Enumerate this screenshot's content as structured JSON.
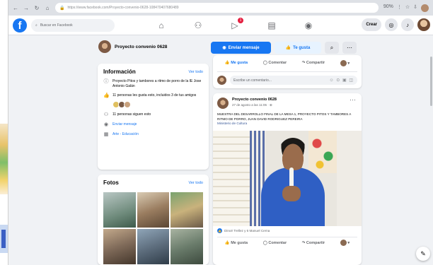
{
  "browser": {
    "url": "https://www.facebook.com/Proyecto-convenio-0628-108470407680489",
    "zoom": "90%"
  },
  "facebook": {
    "search_placeholder": "Buscar en Facebook",
    "crear_label": "Crear",
    "notification_count": "1"
  },
  "page": {
    "name": "Proyecto convenio 0628",
    "send_message_label": "Enviar mensaje",
    "like_label": "Te gusta"
  },
  "info": {
    "title": "Información",
    "see_all": "Ver todo",
    "description": "Proyecto Pitos y tambores a ritmo de porro de la IE Jose Antonio Galán",
    "likes": "11 personas les gusta esto, incluidos 3 de tus amigos",
    "followers": "11 personas siguen esto",
    "send_message": "Enviar mensaje",
    "category": "Arte - Educación"
  },
  "photos": {
    "title": "Fotos",
    "see_all": "Ver todo"
  },
  "composer": {
    "like_label": "Me gusta",
    "comment_label": "Comentar",
    "share_label": "Compartir",
    "placeholder": "Escribe un comentario...",
    "emoji_icons": "☺ ⊙ ▣ ◫"
  },
  "post": {
    "author": "Proyecto convenio 0628",
    "time": "27 de agosto a las 11:06 · ⊕",
    "text": "MUESTRA DEL DESARROLLO FINAL DE LA MESA 1,  PROYECTO PITOS Y TAMBORES A RITMO DE PORRO, JUAN DAVID RODRIGUEZ PEREIRA",
    "link": "Ministerio de Cultura",
    "reactions": "Dinoé Trellez y 6 Manuel Cerna",
    "like_label": "Me gusta",
    "comment_label": "Comentar",
    "share_label": "Compartir"
  }
}
